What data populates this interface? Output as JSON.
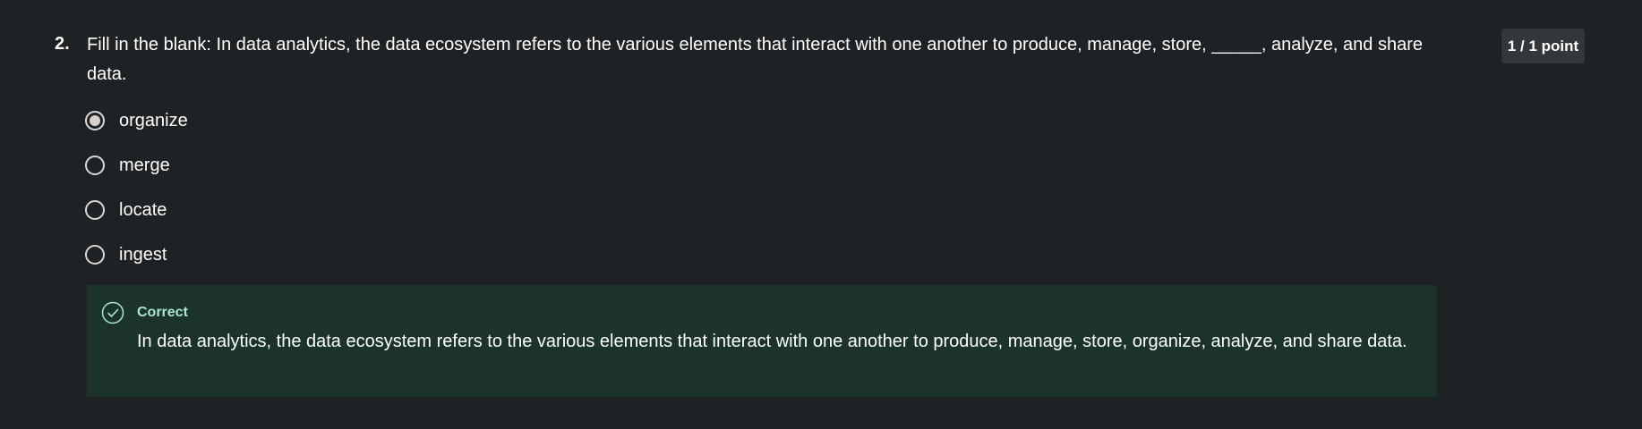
{
  "question": {
    "number": "2.",
    "text": "Fill in the blank: In data analytics, the data ecosystem refers to the various elements that interact with one another to produce, manage, store, _____, analyze, and share data.",
    "points": "1 / 1 point"
  },
  "options": [
    {
      "label": "organize",
      "selected": true
    },
    {
      "label": "merge",
      "selected": false
    },
    {
      "label": "locate",
      "selected": false
    },
    {
      "label": "ingest",
      "selected": false
    }
  ],
  "feedback": {
    "status": "Correct",
    "icon": "check-circle-icon",
    "text": "In data analytics, the data ecosystem refers to the various elements that interact with one another to produce, manage, store, organize, analyze, and share data.",
    "accent_color": "#a8e8d2",
    "background_color": "#1b332b"
  }
}
